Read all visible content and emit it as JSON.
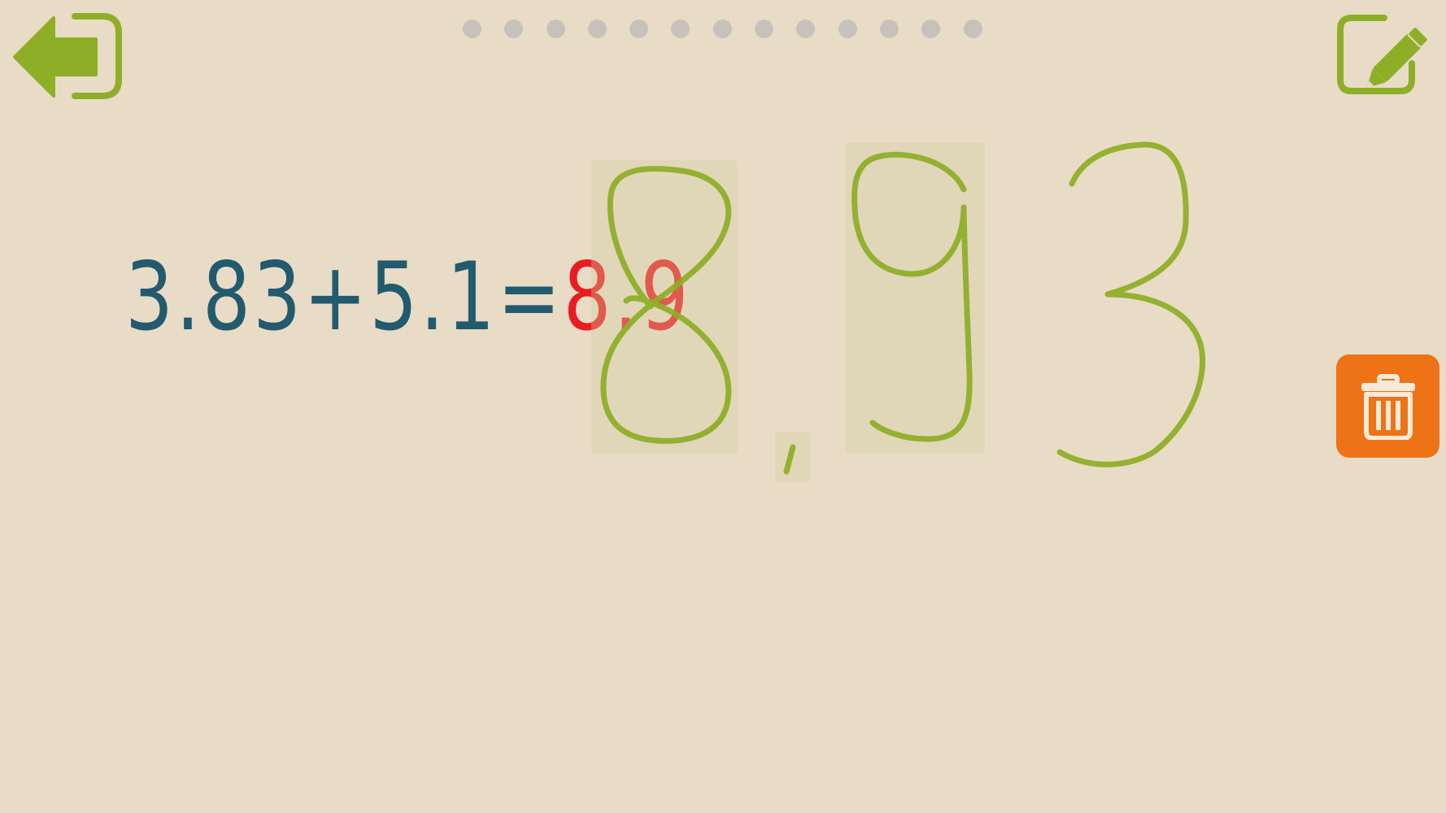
{
  "toolbar": {
    "back_icon": "back-arrow-exit-icon",
    "edit_icon": "pencil-edit-icon",
    "delete_icon": "trash-icon"
  },
  "progress": {
    "total_steps": 13
  },
  "equation": {
    "expression": "3.83+5.1=",
    "answer_shown": "8.9"
  },
  "handwriting": {
    "strokes": [
      "8",
      ",",
      "9",
      "3"
    ]
  },
  "colors": {
    "background": "#e8dcc6",
    "accent_green": "#8fae28",
    "equation_text": "#225a6e",
    "answer_red": "#e81d22",
    "delete_orange": "#ee7216",
    "dot_gray": "#c6c2bb"
  }
}
